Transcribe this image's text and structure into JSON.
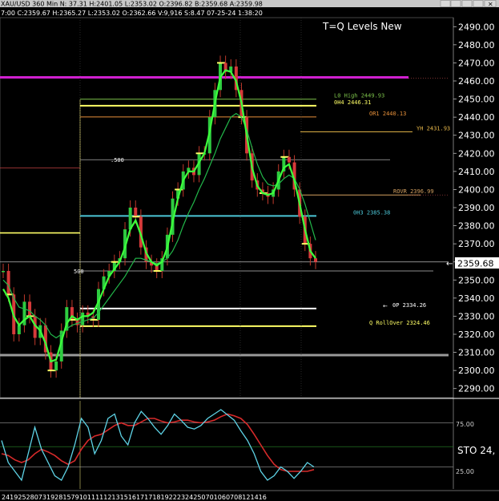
{
  "header": {
    "symbol": "XAU/USD",
    "quote_line": "XAU/USD 360 Min  N:    37.31  H:2401.05  L:2353.02  O:2396.82  B:2359.68  A:2359.98",
    "sub_line": "7:00  C:2359.67  H:2365.27  L:2353.02  O:2362.66  V:9,916  S:8.47  07-25-24  1:38:20",
    "study_title": "T=Q Levels New"
  },
  "window_controls": {
    "icons": [
      "scroll-icon",
      "clock-icon",
      "restore-icon",
      "maximize-icon",
      "close-icon"
    ]
  },
  "price_panel": {
    "last_price": "2359.68",
    "price_arrow": "←",
    "level_lines": [
      {
        "label": "L0 High 2449.93",
        "price": 2449.93,
        "color": "#7cc24a"
      },
      {
        "label": "0H4 2446.31",
        "price": 2446.31,
        "color": "#ffff66"
      },
      {
        "label": "OR1 2440.13",
        "price": 2440.13,
        "color": "#e8913a"
      },
      {
        "label": "YH 2431.93",
        "price": 2431.93,
        "color": "#e8b84a"
      },
      {
        "label": "ROVR 2396.99",
        "price": 2396.99,
        "color": "#d4a060"
      },
      {
        "label": "0H3 2385.38",
        "price": 2385.38,
        "color": "#4cc6d6"
      },
      {
        "label": "0P 2334.26",
        "price": 2334.26,
        "color": "#ffffff"
      },
      {
        "label": "Q RollOver 2324.46",
        "price": 2324.46,
        "color": "#ffff66"
      }
    ],
    "fib_labels": [
      {
        "label": ".500",
        "price": 2416.5
      },
      {
        "label": "500",
        "price": 2355.0
      }
    ],
    "magenta_level": 2462.0,
    "gray_level": 2308.5
  },
  "oscillator_panel": {
    "name": "STO 24,",
    "levels": [
      "75.00",
      "25.00"
    ]
  },
  "time_axis": {
    "ticks": [
      "24",
      "19",
      "25",
      "28",
      "07",
      "31",
      "9",
      "2",
      "8",
      "1",
      "5",
      "7",
      "9",
      "10",
      "11",
      "11",
      "12",
      "13",
      "15",
      "16",
      "17",
      "17",
      "18",
      "19",
      "22",
      "23",
      "24",
      "25",
      "07",
      "01",
      "06",
      "07",
      "08",
      "12",
      "14",
      "16"
    ]
  },
  "chart_data": {
    "type": "candlestick",
    "title": "T=Q Levels New",
    "ylim": [
      2285,
      2495
    ],
    "yticks": [
      2290,
      2300,
      2310,
      2320,
      2330,
      2340,
      2350,
      2360,
      2370,
      2380,
      2390,
      2400,
      2410,
      2420,
      2430,
      2440,
      2450,
      2460,
      2470,
      2480,
      2490
    ],
    "ytick_labels": [
      "2290.00",
      "2300.00",
      "2310.00",
      "2320.00",
      "2330.00",
      "2340.00",
      "2350.00",
      "2360.00",
      "2370.00",
      "2380.00",
      "2390.00",
      "2400.00",
      "2410.00",
      "2420.00",
      "2430.00",
      "2440.00",
      "2450.00",
      "2460.00",
      "2470.00",
      "2480.00",
      "2490.00"
    ],
    "closes": [
      2355,
      2342,
      2320,
      2325,
      2338,
      2330,
      2318,
      2325,
      2310,
      2300,
      2305,
      2322,
      2335,
      2328,
      2325,
      2332,
      2330,
      2328,
      2345,
      2352,
      2355,
      2360,
      2362,
      2378,
      2390,
      2385,
      2368,
      2360,
      2358,
      2355,
      2362,
      2375,
      2395,
      2400,
      2410,
      2412,
      2408,
      2420,
      2420,
      2440,
      2455,
      2470,
      2465,
      2468,
      2455,
      2440,
      2420,
      2405,
      2400,
      2398,
      2396,
      2400,
      2410,
      2418,
      2415,
      2400,
      2385,
      2370,
      2362,
      2360
    ],
    "ma_fast": [
      2345,
      2340,
      2330,
      2325,
      2328,
      2330,
      2325,
      2322,
      2315,
      2305,
      2306,
      2316,
      2326,
      2330,
      2328,
      2330,
      2330,
      2332,
      2338,
      2345,
      2352,
      2356,
      2360,
      2368,
      2378,
      2383,
      2375,
      2365,
      2360,
      2358,
      2360,
      2368,
      2382,
      2395,
      2405,
      2410,
      2410,
      2415,
      2420,
      2432,
      2448,
      2462,
      2466,
      2465,
      2460,
      2448,
      2430,
      2412,
      2402,
      2398,
      2397,
      2398,
      2405,
      2412,
      2414,
      2405,
      2392,
      2378,
      2366,
      2362
    ],
    "ma_slow": [
      2350,
      2347,
      2340,
      2335,
      2334,
      2333,
      2330,
      2328,
      2325,
      2320,
      2318,
      2320,
      2323,
      2325,
      2326,
      2327,
      2328,
      2329,
      2332,
      2336,
      2340,
      2344,
      2348,
      2352,
      2357,
      2362,
      2362,
      2361,
      2360,
      2359,
      2360,
      2362,
      2366,
      2372,
      2380,
      2387,
      2393,
      2400,
      2406,
      2413,
      2420,
      2428,
      2434,
      2440,
      2442,
      2440,
      2433,
      2423,
      2414,
      2407,
      2403,
      2402,
      2403,
      2406,
      2408,
      2406,
      2400,
      2392,
      2382,
      2372
    ],
    "sto_k": [
      55,
      30,
      20,
      10,
      40,
      70,
      45,
      30,
      15,
      10,
      25,
      50,
      80,
      70,
      40,
      55,
      80,
      85,
      60,
      50,
      75,
      88,
      80,
      70,
      62,
      72,
      85,
      78,
      70,
      68,
      72,
      80,
      85,
      90,
      84,
      78,
      66,
      55,
      40,
      20,
      10,
      15,
      25,
      20,
      12,
      20,
      30,
      25
    ],
    "sto_d": [
      40,
      38,
      33,
      30,
      33,
      40,
      45,
      42,
      38,
      32,
      28,
      32,
      45,
      55,
      60,
      62,
      67,
      72,
      75,
      72,
      72,
      76,
      80,
      80,
      77,
      75,
      76,
      78,
      78,
      76,
      75,
      76,
      78,
      82,
      85,
      83,
      80,
      73,
      62,
      50,
      38,
      28,
      22,
      20,
      20,
      20,
      20,
      22
    ]
  }
}
